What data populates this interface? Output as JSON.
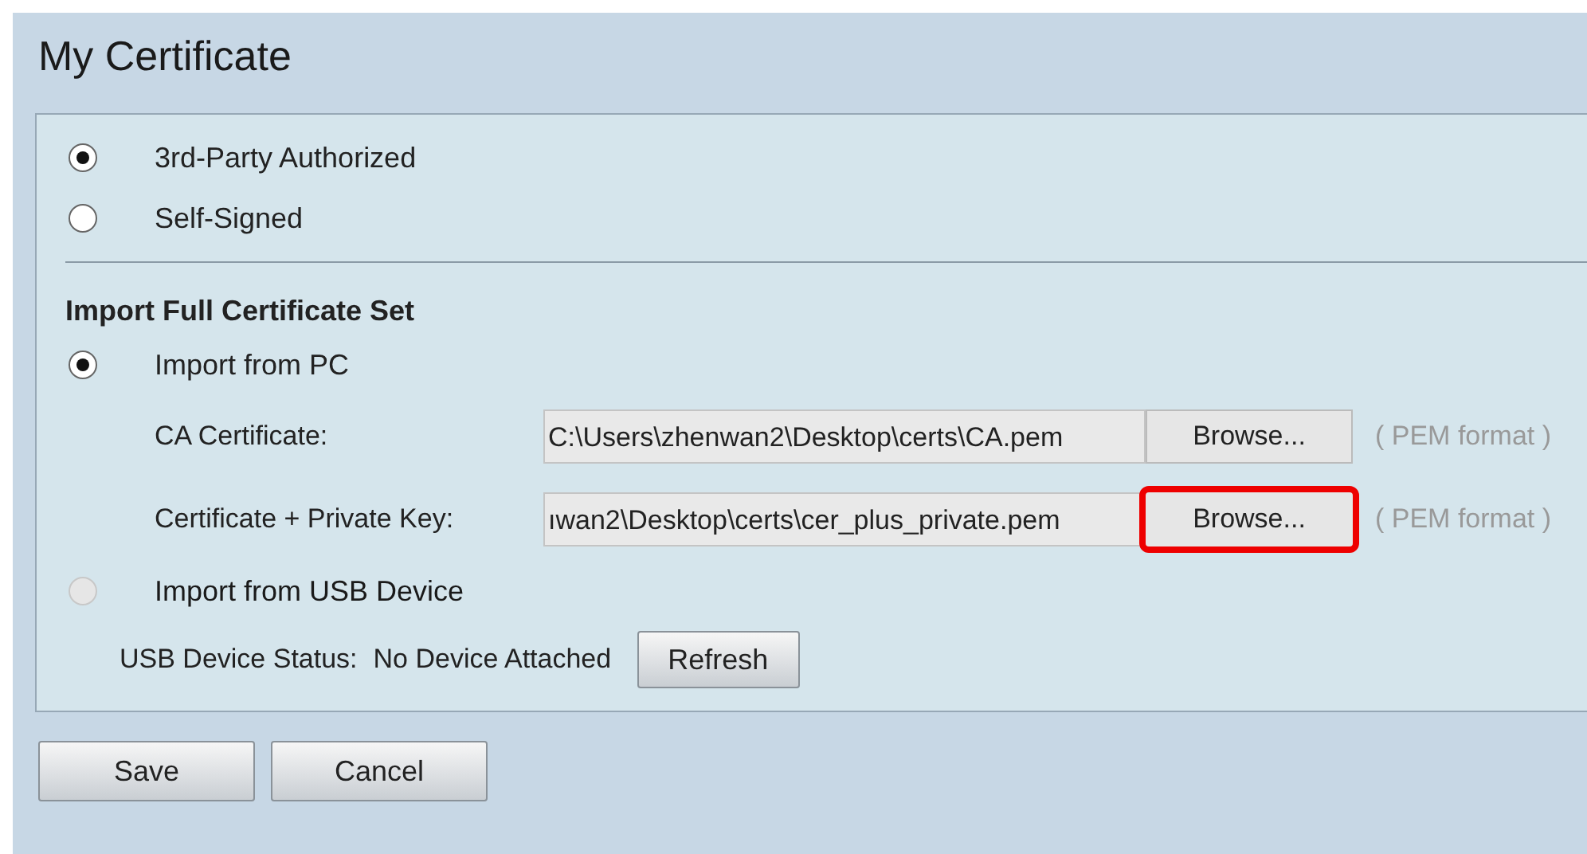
{
  "title": "My Certificate",
  "cert_type": [
    {
      "label": "3rd-Party Authorized",
      "selected": true
    },
    {
      "label": "Self-Signed",
      "selected": false
    }
  ],
  "section_heading": "Import Full Certificate Set",
  "import_pc": {
    "label": "Import from PC",
    "selected": true,
    "disabled": false
  },
  "files": [
    {
      "label": "CA Certificate:",
      "value": "C:\\Users\\zhenwan2\\Desktop\\certs\\CA.pem",
      "button": "Browse...",
      "highlighted": false,
      "hint": "( PEM format )"
    },
    {
      "label": "Certificate + Private Key:",
      "value": "ıwan2\\Desktop\\certs\\cer_plus_private.pem",
      "button": "Browse...",
      "highlighted": true,
      "hint": "( PEM format )"
    }
  ],
  "import_usb": {
    "label": "Import from USB Device",
    "selected": false,
    "disabled": true
  },
  "usb_status": {
    "label": "USB Device Status:",
    "value": "No Device Attached",
    "button": "Refresh"
  },
  "buttons": [
    "Save",
    "Cancel"
  ]
}
